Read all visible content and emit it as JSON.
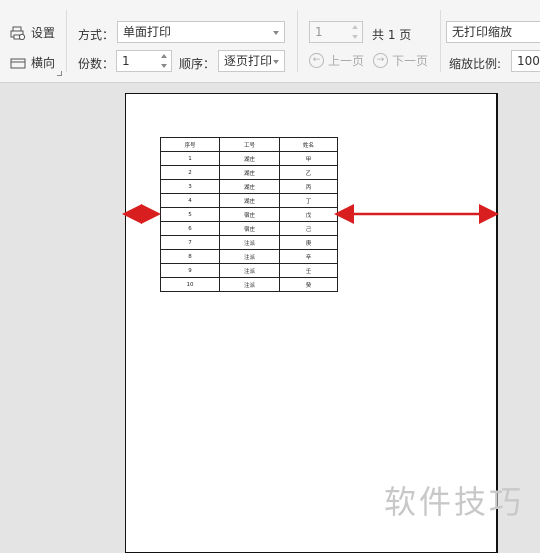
{
  "toolbar": {
    "settings_label": "设置",
    "landscape_label": "横向",
    "mode_label": "方式：",
    "mode_value": "单面打印",
    "copies_label": "份数：",
    "copies_value": "1",
    "order_label": "顺序：",
    "order_value": "逐页打印",
    "page_value": "1",
    "total_pages": "共 1 页",
    "prev_page": "上一页",
    "next_page": "下一页",
    "scaling_value": "无打印缩放",
    "zoom_label": "缩放比例:",
    "zoom_value": "100"
  },
  "sheet": {
    "headers": [
      "序号",
      "工号",
      "姓名"
    ],
    "rows": [
      [
        "1",
        "湖庄",
        "甲"
      ],
      [
        "2",
        "湖庄",
        "乙"
      ],
      [
        "3",
        "湖庄",
        "丙"
      ],
      [
        "4",
        "湖庄",
        "丁"
      ],
      [
        "5",
        "宿庄",
        "戊"
      ],
      [
        "6",
        "宿庄",
        "己"
      ],
      [
        "7",
        "注派",
        "庚"
      ],
      [
        "8",
        "注派",
        "辛"
      ],
      [
        "9",
        "注派",
        "壬"
      ],
      [
        "10",
        "注派",
        "癸"
      ]
    ]
  },
  "watermark": "软件技巧",
  "colors": {
    "arrow": "#d81e1e",
    "toolbar_bg": "#f5f5f5",
    "canvas_bg": "#e4e4e4"
  }
}
